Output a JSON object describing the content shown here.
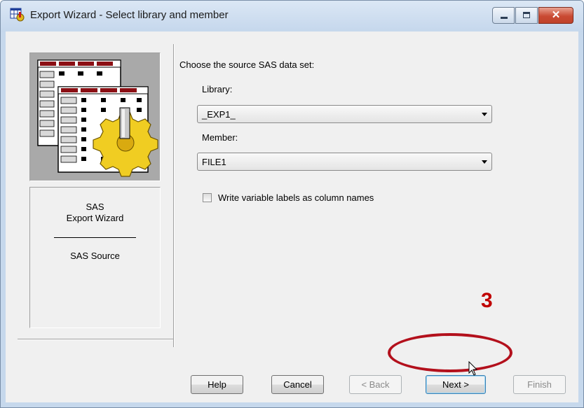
{
  "window": {
    "title": "Export Wizard - Select library and member",
    "icon": "sas-export-app-icon",
    "controls": {
      "minimize": "minimize-icon",
      "maximize": "maximize-icon",
      "close": "close-icon"
    }
  },
  "sidebar": {
    "graphic": "data-table-gear-illustration",
    "wizard_name": "SAS\nExport Wizard",
    "step_name": "SAS Source"
  },
  "form": {
    "prompt": "Choose the source SAS data set:",
    "library_label": "Library:",
    "library_value": "_EXP1_",
    "member_label": "Member:",
    "member_value": "FILE1",
    "checkbox_label": "Write variable labels as column names",
    "checkbox_checked": false
  },
  "buttons": {
    "help": "Help",
    "cancel": "Cancel",
    "back": "< Back",
    "next": "Next >",
    "finish": "Finish"
  },
  "annotation": {
    "step_number": "3",
    "color": "#c00000"
  }
}
